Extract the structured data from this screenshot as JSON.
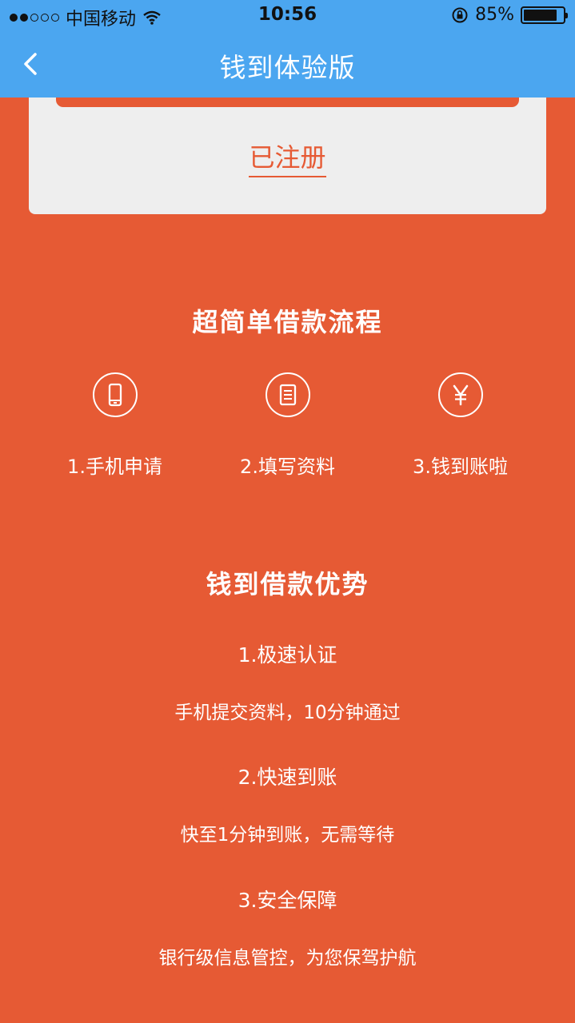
{
  "status": {
    "carrier": "中国移动",
    "time": "10:56",
    "battery_pct_text": "85%",
    "battery_level": 0.85,
    "signal_bars": 2
  },
  "nav": {
    "title": "钱到体验版",
    "back_icon": "chevron-left-icon"
  },
  "card": {
    "registered_link": "已注册"
  },
  "process": {
    "title": "超简单借款流程",
    "steps": [
      {
        "icon": "mobile-phone-icon",
        "label": "1.手机申请"
      },
      {
        "icon": "document-icon",
        "label": "2.填写资料"
      },
      {
        "icon": "yen-icon",
        "label": "3.钱到账啦"
      }
    ]
  },
  "advantages": {
    "title": "钱到借款优势",
    "items": [
      {
        "heading": "1.极速认证",
        "desc": "手机提交资料，10分钟通过"
      },
      {
        "heading": "2.快速到账",
        "desc": "快至1分钟到账，无需等待"
      },
      {
        "heading": "3.安全保障",
        "desc": "银行级信息管控，为您保驾护航"
      }
    ]
  },
  "colors": {
    "nav_bg": "#4BA6F0",
    "page_bg": "#E65A34",
    "card_bg": "#EEEEEE"
  }
}
